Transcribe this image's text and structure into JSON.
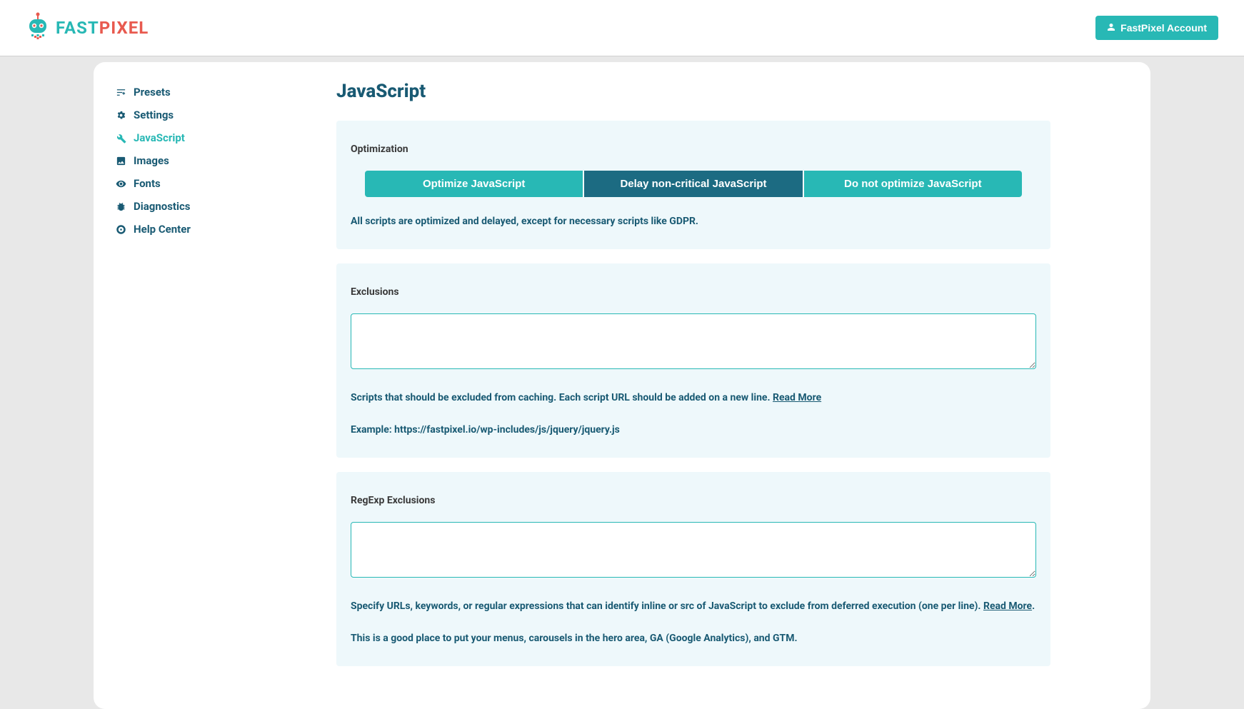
{
  "header": {
    "logo_fast": "FAST",
    "logo_pixel": "PIXEL",
    "account_label": "FastPixel Account"
  },
  "sidebar": {
    "items": [
      {
        "id": "presets",
        "label": "Presets"
      },
      {
        "id": "settings",
        "label": "Settings"
      },
      {
        "id": "javascript",
        "label": "JavaScript"
      },
      {
        "id": "images",
        "label": "Images"
      },
      {
        "id": "fonts",
        "label": "Fonts"
      },
      {
        "id": "diagnostics",
        "label": "Diagnostics"
      },
      {
        "id": "help",
        "label": "Help Center"
      }
    ],
    "active_id": "javascript"
  },
  "page": {
    "title": "JavaScript",
    "optimization": {
      "title": "Optimization",
      "options": [
        "Optimize JavaScript",
        "Delay non-critical JavaScript",
        "Do not optimize JavaScript"
      ],
      "selected_index": 1,
      "help": "All scripts are optimized and delayed, except for necessary scripts like GDPR."
    },
    "exclusions": {
      "title": "Exclusions",
      "value": "",
      "help_1": "Scripts that should be excluded from caching. Each script URL should be added on a new line. ",
      "read_more": "Read More",
      "help_2": "Example: https://fastpixel.io/wp-includes/js/jquery/jquery.js"
    },
    "regexp": {
      "title": "RegExp Exclusions",
      "value": "",
      "help_1": "Specify URLs, keywords, or regular expressions that can identify inline or src of JavaScript to exclude from deferred execution (one per line). ",
      "read_more": "Read More",
      "help_1_tail": ".",
      "help_2": "This is a good place to put your menus, carousels in the hero area, GA (Google Analytics), and GTM."
    }
  }
}
